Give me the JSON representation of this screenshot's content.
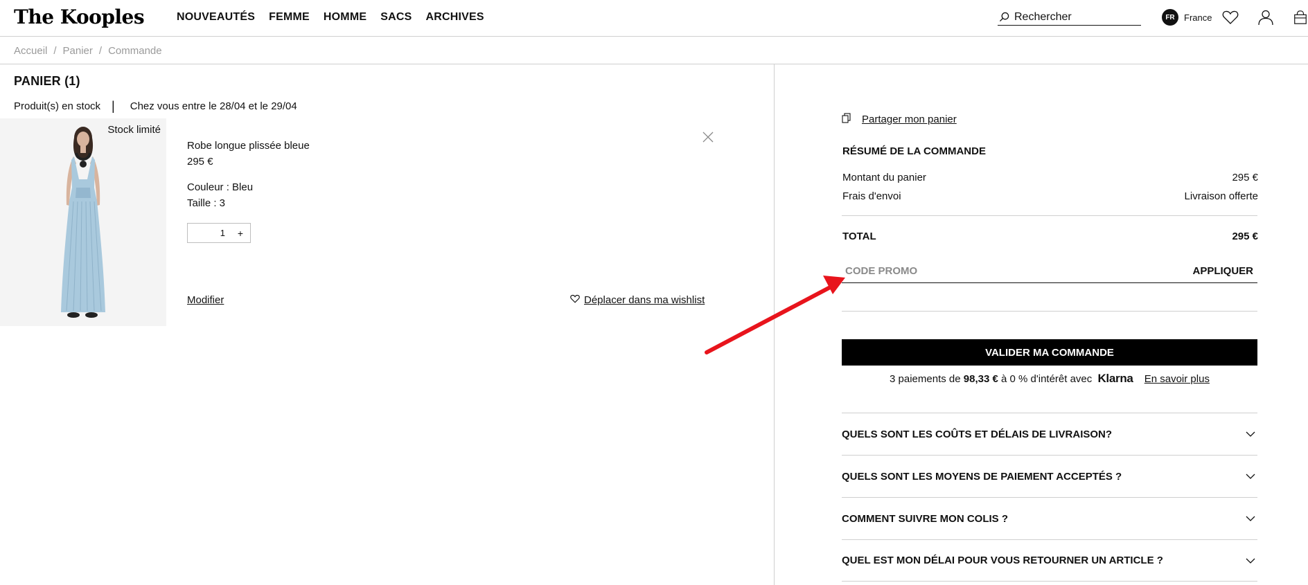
{
  "header": {
    "logo": "The Kooples",
    "nav": [
      "NOUVEAUTÉS",
      "FEMME",
      "HOMME",
      "SACS",
      "ARCHIVES"
    ],
    "search_placeholder": "Rechercher",
    "country_code": "FR",
    "country_label": "France"
  },
  "breadcrumb": {
    "items": [
      "Accueil",
      "Panier",
      "Commande"
    ],
    "separator": "/"
  },
  "cart": {
    "title": "PANIER (1)",
    "stock_status": "Produit(s) en stock",
    "separator": "|",
    "delivery": "Chez vous entre le 28/04 et le 29/04",
    "item": {
      "badge": "Stock limité",
      "name": "Robe longue plissée bleue",
      "price": "295 €",
      "color": "Couleur : Bleu",
      "size": "Taille : 3",
      "quantity": "1",
      "plus": "+",
      "modify": "Modifier",
      "wishlist": "Déplacer dans ma wishlist"
    }
  },
  "summary": {
    "share": "Partager mon panier",
    "title": "RÉSUMÉ DE LA COMMANDE",
    "cart_amount_label": "Montant du panier",
    "cart_amount_value": "295 €",
    "shipping_label": "Frais d'envoi",
    "shipping_value": "Livraison offerte",
    "total_label": "TOTAL",
    "total_value": "295 €",
    "promo_placeholder": "CODE PROMO",
    "promo_apply": "APPLIQUER",
    "validate": "VALIDER MA COMMANDE",
    "klarna": {
      "prefix": "3 paiements de",
      "amount": "98,33 €",
      "middle": "à 0 % d'intérêt avec",
      "brand": "Klarna",
      "more": "En savoir plus"
    }
  },
  "faq": [
    "QUELS SONT LES COÛTS ET DÉLAIS DE LIVRAISON?",
    "QUELS SONT LES MOYENS DE PAIEMENT ACCEPTÉS ?",
    "COMMENT SUIVRE MON COLIS ?",
    "QUEL EST MON DÉLAI POUR VOUS RETOURNER UN ARTICLE ?"
  ],
  "colors": {
    "accent": "#000000",
    "annotation_arrow": "#e8141c",
    "breadcrumb": "#9a9a9a",
    "divider": "#cfcfcf"
  }
}
